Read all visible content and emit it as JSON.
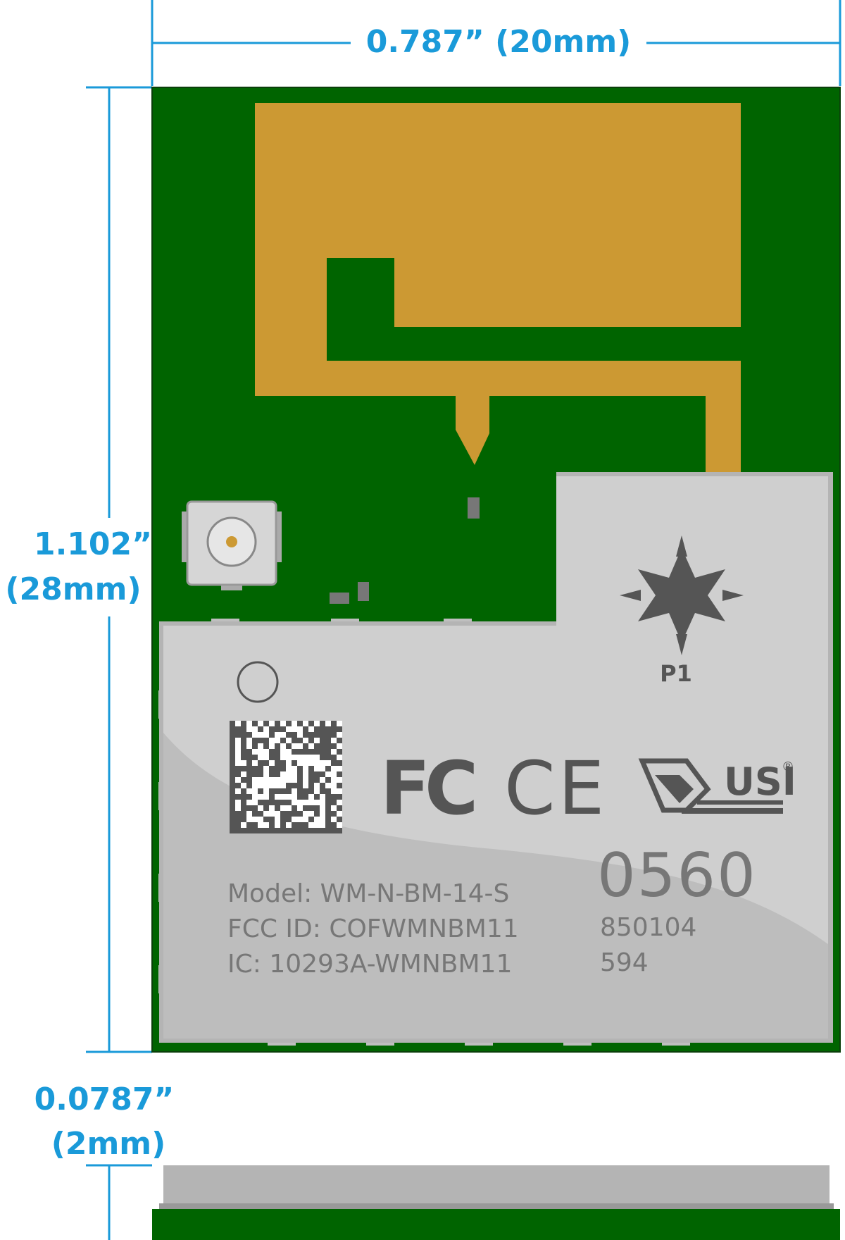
{
  "colors": {
    "dimension": "#1a9ad9",
    "pcb": "#006400",
    "antenna": "#cc9933",
    "shield": "#cfcfcf",
    "shield_edge": "#b4b4b4",
    "marking": "#555555"
  },
  "dimensions": {
    "width_label": "0.787” (20mm)",
    "height_inches": "1.102”",
    "height_mm": "(28mm)",
    "thickness_inches": "0.0787”",
    "thickness_mm": "(2mm)"
  },
  "shield": {
    "pin_label": "P1",
    "lot_code": "0560",
    "code_line_1": "850104",
    "code_line_2": "594",
    "model_line": "Model: WM-N-BM-14-S",
    "fcc_id_line": "FCC ID: COFWMNBM11",
    "ic_line": "IC: 10293A-WMNBM11",
    "logos": {
      "fcc": "FC",
      "ce": "CE",
      "usi": "USI",
      "registered": "®"
    }
  },
  "icons": [
    "star-logo-icon",
    "fcc-logo-icon",
    "ce-logo-icon",
    "usi-logo-icon",
    "datamatrix-icon",
    "ufl-connector-icon",
    "pin1-circle-icon"
  ]
}
